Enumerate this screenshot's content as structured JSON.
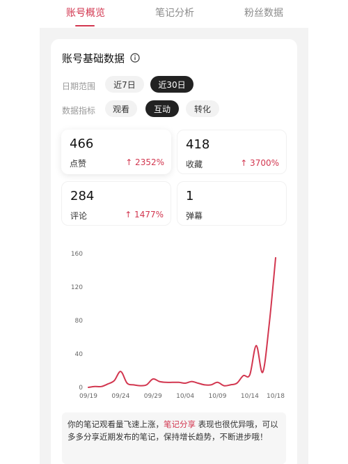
{
  "tabs": [
    {
      "label": "账号概览",
      "active": true
    },
    {
      "label": "笔记分析",
      "active": false
    },
    {
      "label": "粉丝数据",
      "active": false
    }
  ],
  "card": {
    "title": "账号基础数据",
    "date_range_label": "日期范围",
    "date_options": [
      {
        "label": "近7日",
        "active": false
      },
      {
        "label": "近30日",
        "active": true
      }
    ],
    "metric_label": "数据指标",
    "metric_options": [
      {
        "label": "观看",
        "active": false
      },
      {
        "label": "互动",
        "active": true
      },
      {
        "label": "转化",
        "active": false
      }
    ]
  },
  "stats": [
    {
      "value": "466",
      "label": "点赞",
      "growth": "↑ 2352%"
    },
    {
      "value": "418",
      "label": "收藏",
      "growth": "↑ 3700%"
    },
    {
      "value": "284",
      "label": "评论",
      "growth": "↑ 1477%"
    },
    {
      "value": "1",
      "label": "弹幕",
      "growth": ""
    }
  ],
  "chart_data": {
    "type": "line",
    "color": "#d2364f",
    "ylim": [
      0,
      160
    ],
    "yticks": [
      0,
      40,
      80,
      120,
      160
    ],
    "xtick_labels": [
      "09/19",
      "09/24",
      "09/29",
      "10/04",
      "10/09",
      "10/14",
      "10/18"
    ],
    "x": [
      "09/19",
      "09/20",
      "09/21",
      "09/22",
      "09/23",
      "09/24",
      "09/25",
      "09/26",
      "09/27",
      "09/28",
      "09/29",
      "09/30",
      "10/01",
      "10/02",
      "10/03",
      "10/04",
      "10/05",
      "10/06",
      "10/07",
      "10/08",
      "10/09",
      "10/10",
      "10/11",
      "10/12",
      "10/13",
      "10/14",
      "10/15",
      "10/16",
      "10/17",
      "10/18"
    ],
    "series": [
      {
        "values": [
          0,
          1,
          1,
          4,
          8,
          19,
          5,
          3,
          2,
          3,
          10,
          7,
          6,
          6,
          6,
          5,
          7,
          5,
          3,
          3,
          6,
          2,
          3,
          5,
          14,
          15,
          50,
          18,
          75,
          155
        ]
      }
    ],
    "grid": false
  },
  "tip": {
    "part1": "你的笔记观看量飞速上涨，",
    "highlight": "笔记分享",
    "part2": " 表现也很优异哦，可以多多分享近期发布的笔记，保持增长趋势，不断进步哦！"
  }
}
